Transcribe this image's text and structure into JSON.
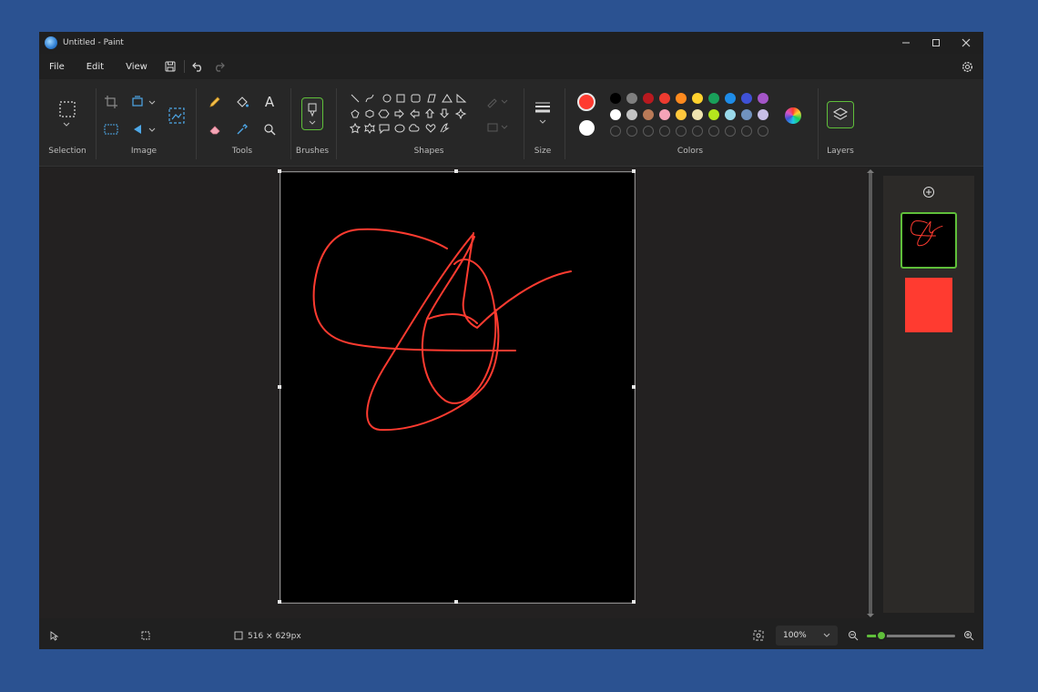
{
  "window": {
    "title": "Untitled - Paint"
  },
  "menu": {
    "file": "File",
    "edit": "Edit",
    "view": "View"
  },
  "ribbon": {
    "groups": {
      "selection": "Selection",
      "image": "Image",
      "tools": "Tools",
      "brushes": "Brushes",
      "shapes": "Shapes",
      "size": "Size",
      "colors": "Colors",
      "layers": "Layers"
    },
    "tools": {
      "text_tool_glyph": "A"
    },
    "active_colors": {
      "primary": "#ff3b30",
      "secondary": "#ffffff"
    },
    "palette_row1": [
      "#000000",
      "#7f7f7f",
      "#b9191f",
      "#ee3b30",
      "#ff8a1e",
      "#ffd22e",
      "#19a05a",
      "#1e8ce8",
      "#3f51d6",
      "#a455c8"
    ],
    "palette_row2": [
      "#ffffff",
      "#c3c3c3",
      "#b97a57",
      "#f5a3b8",
      "#ffc83c",
      "#efe4b0",
      "#b5e61d",
      "#99d9ea",
      "#7092be",
      "#c8bfe7"
    ],
    "palette_row3_empty": 10
  },
  "status": {
    "canvas_size": "516 × 629px",
    "zoom": "100%",
    "zoom_level_percent": 16
  },
  "colors": {
    "accent": "#5fbf3a",
    "stroke": "#ff3b30"
  }
}
